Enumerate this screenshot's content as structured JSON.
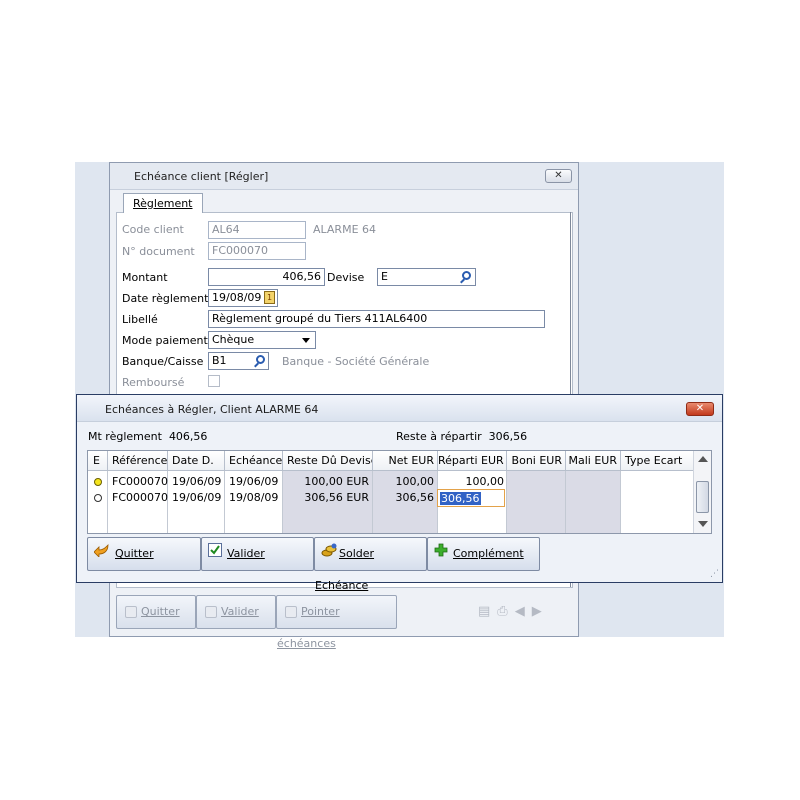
{
  "back_window": {
    "title": "Echéance client [Régler]",
    "close_glyph": "✕",
    "tab_label": "Règlement",
    "fields": {
      "code_client_label": "Code client",
      "code_client_value": "AL64",
      "code_client_name": "ALARME 64",
      "document_label": "N° document",
      "document_value": "FC000070",
      "montant_label": "Montant",
      "montant_value": "406,56",
      "devise_label": "Devise",
      "devise_value": "E",
      "date_label": "Date règlement",
      "date_value": "19/08/09",
      "libelle_label": "Libellé",
      "libelle_value": "Règlement groupé du Tiers 411AL6400",
      "mode_label": "Mode paiement",
      "mode_value": "Chèque",
      "banque_label": "Banque/Caisse",
      "banque_value": "B1",
      "banque_name": "Banque - Société Générale",
      "rembourse_label": "Remboursé"
    },
    "buttons": {
      "quitter": "Quitter",
      "valider": "Valider",
      "pointer": "Pointer échéances"
    }
  },
  "front_dialog": {
    "title": "Echéances à Régler, Client ALARME 64",
    "close_glyph": "✕",
    "mt_reglement_label": "Mt règlement",
    "mt_reglement_value": "406,56",
    "reste_label": "Reste à répartir",
    "reste_value": "306,56",
    "columns": [
      "E",
      "Référence",
      "Date D.",
      "Echéance",
      "Reste Dû Devise",
      "Net EUR",
      "Réparti EUR",
      "Boni EUR",
      "Mali EUR",
      "Type Ecart"
    ],
    "rows": [
      {
        "e": "yellow",
        "reference": "FC000070",
        "date_d": "19/06/09",
        "echeance": "19/06/09",
        "reste_du": "100,00 EUR",
        "net": "100,00",
        "reparti": "100,00",
        "boni": "",
        "mali": "",
        "type_ecart": ""
      },
      {
        "e": "white",
        "reference": "FC000070",
        "date_d": "19/06/09",
        "echeance": "19/08/09",
        "reste_du": "306,56 EUR",
        "net": "306,56",
        "reparti": "306,56",
        "boni": "",
        "mali": "",
        "type_ecart": ""
      }
    ],
    "buttons": {
      "quitter": "Quitter",
      "valider": "Valider",
      "solder": "Solder Echéance",
      "complement": "Complément"
    }
  }
}
